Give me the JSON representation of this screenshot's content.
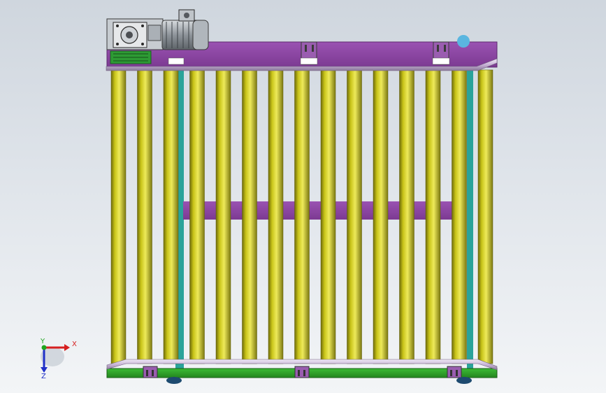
{
  "triad": {
    "x_label": "X",
    "y_label": "Y",
    "z_label": "Z",
    "x_color": "#d62020",
    "y_color": "#1fa51f",
    "z_color": "#2030c8"
  },
  "colors": {
    "roller": "#c9c419",
    "frame_top": "#8f48a6",
    "frame_bottom": "#2fa22a",
    "side_rail": "#2aa39a",
    "guard_rail": "#c8b6d8",
    "motor": "#9aa0a6",
    "gearbox": "#b6bcc2"
  },
  "conveyor": {
    "roller_count": 15
  }
}
